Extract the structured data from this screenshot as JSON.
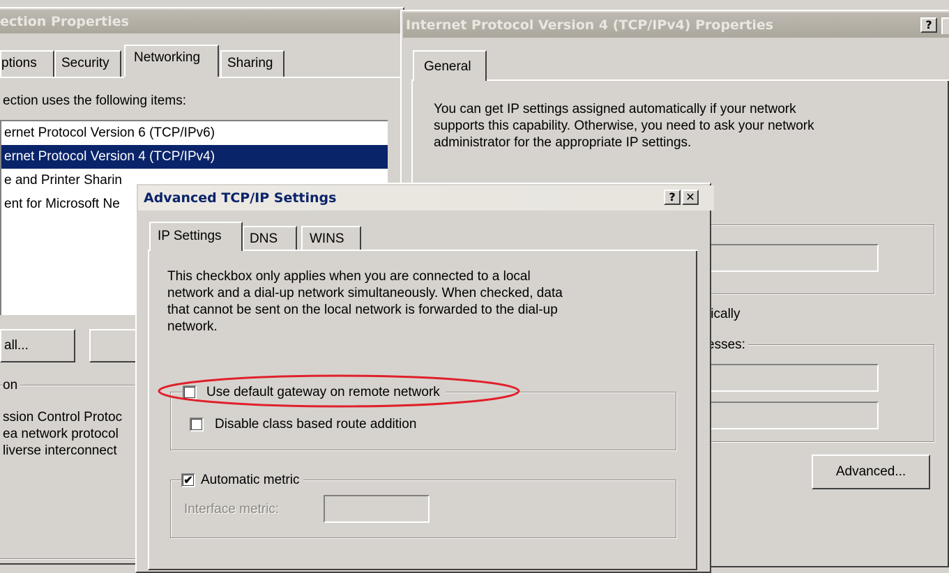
{
  "left_window": {
    "title": "ection Properties",
    "tabs": [
      "ptions",
      "Security",
      "Networking",
      "Sharing"
    ],
    "items_label": "ection uses the following items:",
    "list": [
      {
        "label": "ernet Protocol Version 6 (TCP/IPv6)",
        "selected": false
      },
      {
        "label": "ernet Protocol Version 4 (TCP/IPv4)",
        "selected": true
      },
      {
        "label": "e and Printer Sharin",
        "selected": false
      },
      {
        "label": "ent for Microsoft Ne",
        "selected": false
      }
    ],
    "install_button": "all...",
    "description_group": "on",
    "description": [
      "ssion Control Protoc",
      "ea network protocol",
      "liverse interconnect"
    ]
  },
  "ipv4_window": {
    "title": "Internet Protocol Version 4 (TCP/IPv4) Properties",
    "help_button": "?",
    "tab": "General",
    "intro": [
      "You can get IP settings assigned automatically if your network",
      "supports this capability. Otherwise, you need to ask your network",
      "administrator for the appropriate IP settings."
    ],
    "auto_dns_fragment": "tically",
    "dns_group_fragment": "esses:",
    "advanced_button": "Advanced..."
  },
  "advanced_dialog": {
    "title": "Advanced TCP/IP Settings",
    "help_button": "?",
    "close_button": "✕",
    "tabs": [
      "IP Settings",
      "DNS",
      "WINS"
    ],
    "description": [
      "This checkbox only applies when you are connected to a local",
      "network and a dial-up network simultaneously.  When checked, data",
      "that cannot be sent on the local network is forwarded to the dial-up",
      "network."
    ],
    "use_default_gateway": {
      "label": "Use default gateway on remote network",
      "checked": false
    },
    "disable_class_route": {
      "label": "Disable class based route addition",
      "checked": false
    },
    "automatic_metric": {
      "label": "Automatic metric",
      "checked": true,
      "check_glyph": "✔"
    },
    "interface_metric_label": "Interface metric:",
    "interface_metric_value": ""
  },
  "highlight_color": "#e0202a"
}
